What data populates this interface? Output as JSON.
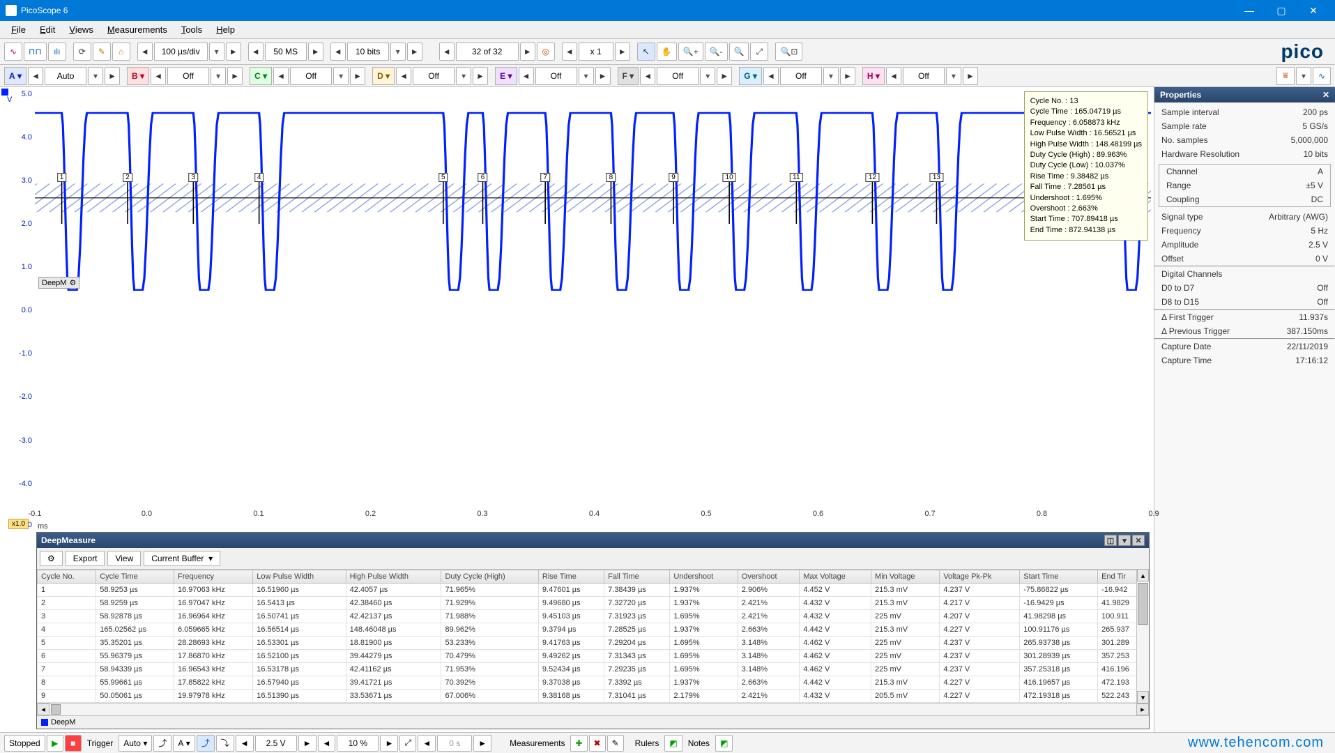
{
  "app": {
    "title": "PicoScope 6"
  },
  "menu": {
    "file": "File",
    "edit": "Edit",
    "views": "Views",
    "measurements": "Measurements",
    "tools": "Tools",
    "help": "Help"
  },
  "toolbar1": {
    "timediv": "100 µs/div",
    "samples": "50 MS",
    "bits": "10 bits",
    "buffer": "32 of 32",
    "zoom": "x 1",
    "logo": "pico"
  },
  "channels": {
    "A": {
      "label": "A",
      "val": "Auto",
      "dd": "▾"
    },
    "B": {
      "label": "B",
      "val": "Off"
    },
    "C": {
      "label": "C",
      "val": "Off"
    },
    "D": {
      "label": "D",
      "val": "Off"
    },
    "E": {
      "label": "E",
      "val": "Off"
    },
    "F": {
      "label": "F",
      "val": "Off"
    },
    "G": {
      "label": "G",
      "val": "Off"
    },
    "H": {
      "label": "H",
      "val": "Off"
    }
  },
  "yaxis": {
    "unit": "V",
    "ticks": [
      "5.0",
      "4.0",
      "3.0",
      "2.0",
      "1.0",
      "0.0",
      "-1.0",
      "-2.0",
      "-3.0",
      "-4.0",
      "-5.0"
    ]
  },
  "xaxis": {
    "unit": "ms",
    "zoom": "x1.0",
    "ticks": [
      "-0.1",
      "0.0",
      "0.1",
      "0.2",
      "0.3",
      "0.4",
      "0.5",
      "0.6",
      "0.7",
      "0.8",
      "0.9"
    ]
  },
  "cycle_markers": [
    "1",
    "2",
    "3",
    "4",
    "5",
    "6",
    "7",
    "8",
    "9",
    "10",
    "11",
    "12",
    "13"
  ],
  "deepm_badge": "DeepM",
  "info": [
    "Cycle No. :  13",
    "Cycle Time :  165.04719 µs",
    "Frequency :  6.058873 kHz",
    "Low Pulse Width :  16.56521 µs",
    "High Pulse Width :  148.48199 µs",
    "Duty Cycle (High) :  89.963%",
    "Duty Cycle (Low) :  10.037%",
    "Rise Time :  9.38482 µs",
    "Fall Time :  7.28561 µs",
    "Undershoot :  1.695%",
    "Overshoot :  2.663%",
    "Start Time :  707.89418 µs",
    "End Time :  872.94138 µs"
  ],
  "deepm": {
    "title": "DeepMeasure",
    "export": "Export",
    "view": "View",
    "buffer": "Current Buffer",
    "foot": "DeepM",
    "headers": [
      "Cycle No.",
      "Cycle Time",
      "Frequency",
      "Low Pulse Width",
      "High Pulse Width",
      "Duty Cycle (High)",
      "Rise Time",
      "Fall Time",
      "Undershoot",
      "Overshoot",
      "Max Voltage",
      "Min Voltage",
      "Voltage Pk-Pk",
      "Start Time",
      "End Tir"
    ],
    "rows": [
      [
        "1",
        "58.9253 µs",
        "16.97063 kHz",
        "16.51960 µs",
        "42.4057 µs",
        "71.965%",
        "9.47601 µs",
        "7.38439 µs",
        "1.937%",
        "2.906%",
        "4.452 V",
        "215.3 mV",
        "4.237 V",
        "-75.86822 µs",
        "-16.942"
      ],
      [
        "2",
        "58.9259 µs",
        "16.97047 kHz",
        "16.5413 µs",
        "42.38460 µs",
        "71.929%",
        "9.49680 µs",
        "7.32720 µs",
        "1.937%",
        "2.421%",
        "4.432 V",
        "215.3 mV",
        "4.217 V",
        "-16.9429 µs",
        "41.9829"
      ],
      [
        "3",
        "58.92878 µs",
        "16.96964 kHz",
        "16.50741 µs",
        "42.42137 µs",
        "71.988%",
        "9.45103 µs",
        "7.31923 µs",
        "1.695%",
        "2.421%",
        "4.432 V",
        "225 mV",
        "4.207 V",
        "41.98298 µs",
        "100.911"
      ],
      [
        "4",
        "165.02562 µs",
        "6.059665 kHz",
        "16.56514 µs",
        "148.46048 µs",
        "89.962%",
        "9.3794 µs",
        "7.28525 µs",
        "1.937%",
        "2.663%",
        "4.442 V",
        "215.3 mV",
        "4.227 V",
        "100.91176 µs",
        "265.937"
      ],
      [
        "5",
        "35.35201 µs",
        "28.28693 kHz",
        "16.53301 µs",
        "18.81900 µs",
        "53.233%",
        "9.41763 µs",
        "7.29204 µs",
        "1.695%",
        "3.148%",
        "4.462 V",
        "225 mV",
        "4.237 V",
        "265.93738 µs",
        "301.289"
      ],
      [
        "6",
        "55.96379 µs",
        "17.86870 kHz",
        "16.52100 µs",
        "39.44279 µs",
        "70.479%",
        "9.49262 µs",
        "7.31343 µs",
        "1.695%",
        "3.148%",
        "4.462 V",
        "225 mV",
        "4.237 V",
        "301.28939 µs",
        "357.253"
      ],
      [
        "7",
        "58.94339 µs",
        "16.96543 kHz",
        "16.53178 µs",
        "42.41162 µs",
        "71.953%",
        "9.52434 µs",
        "7.29235 µs",
        "1.695%",
        "3.148%",
        "4.462 V",
        "225 mV",
        "4.237 V",
        "357.25318 µs",
        "416.196"
      ],
      [
        "8",
        "55.99661 µs",
        "17.85822 kHz",
        "16.57940 µs",
        "39.41721 µs",
        "70.392%",
        "9.37038 µs",
        "7.3392 µs",
        "1.937%",
        "2.663%",
        "4.442 V",
        "215.3 mV",
        "4.227 V",
        "416.19657 µs",
        "472.193"
      ],
      [
        "9",
        "50.05061 µs",
        "19.97978 kHz",
        "16.51390 µs",
        "33.53671 µs",
        "67.006%",
        "9.38168 µs",
        "7.31041 µs",
        "2.179%",
        "2.421%",
        "4.432 V",
        "205.5 mV",
        "4.227 V",
        "472.19318 µs",
        "522.243"
      ]
    ]
  },
  "properties": {
    "title": "Properties",
    "rows1": [
      [
        "Sample interval",
        "200 ps"
      ],
      [
        "Sample rate",
        "5 GS/s"
      ],
      [
        "No. samples",
        "5,000,000"
      ],
      [
        "Hardware Resolution",
        "10 bits"
      ]
    ],
    "group": [
      [
        "Channel",
        "A"
      ],
      [
        "Range",
        "±5 V"
      ],
      [
        "Coupling",
        "DC"
      ]
    ],
    "rows2": [
      [
        "Signal type",
        "Arbitrary (AWG)"
      ],
      [
        "Frequency",
        "5 Hz"
      ],
      [
        "Amplitude",
        "2.5 V"
      ],
      [
        "Offset",
        "0 V"
      ]
    ],
    "rows3": [
      [
        "Digital Channels",
        ""
      ],
      [
        "D0 to D7",
        "Off"
      ],
      [
        "D8 to D15",
        "Off"
      ]
    ],
    "rows4": [
      [
        "Δ First Trigger",
        "11.937s"
      ],
      [
        "Δ Previous Trigger",
        "387.150ms"
      ]
    ],
    "rows5": [
      [
        "Capture Date",
        "22/11/2019"
      ],
      [
        "Capture Time",
        "17:16:12"
      ]
    ]
  },
  "status": {
    "state": "Stopped",
    "trigger_lbl": "Trigger",
    "trigger_mode": "Auto",
    "trigger_ch": "A",
    "level": "2.5 V",
    "pretrig": "10 %",
    "delay": "0 s",
    "meas": "Measurements",
    "rulers": "Rulers",
    "notes": "Notes",
    "link": "www.tehencom.com"
  },
  "chart_data": {
    "type": "line",
    "title": "",
    "xlabel": "ms",
    "ylabel": "V",
    "xlim": [
      -0.1,
      0.9
    ],
    "ylim": [
      -5.0,
      5.0
    ],
    "series": [
      {
        "name": "Channel A",
        "color": "#0020ff",
        "description": "Pulse train, high ≈ 4.45 V, low ≈ 0.22 V, 13 cycles visible between ≈-0.076 ms and ≈0.873 ms",
        "cycle_starts_ms": [
          -0.0759,
          -0.0169,
          0.042,
          0.1009,
          0.2659,
          0.3013,
          0.3573,
          0.4162,
          0.4722,
          0.5222,
          0.5823,
          0.6504,
          0.7079,
          0.8729
        ],
        "high_level_V": 4.45,
        "low_level_V": 0.22
      }
    ]
  }
}
